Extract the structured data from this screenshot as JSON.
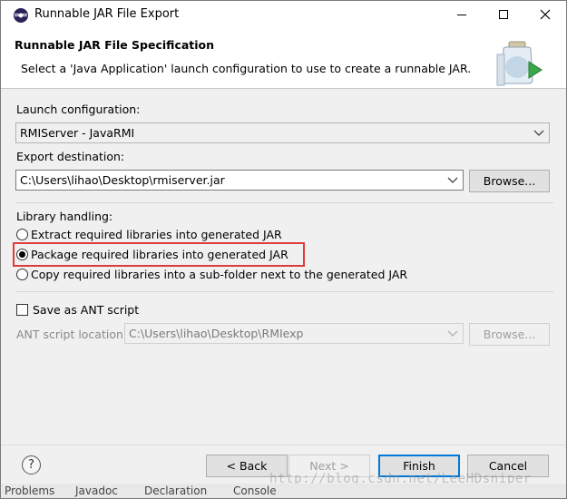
{
  "window": {
    "title": "Runnable JAR File Export"
  },
  "header": {
    "title": "Runnable JAR File Specification",
    "description": "Select a 'Java Application' launch configuration to use to create a runnable JAR."
  },
  "launch": {
    "label": "Launch configuration:",
    "value": "RMIServer - JavaRMI"
  },
  "export": {
    "label": "Export destination:",
    "value": "C:\\Users\\lihao\\Desktop\\rmiserver.jar",
    "browse_label": "Browse..."
  },
  "library": {
    "label": "Library handling:",
    "options": [
      {
        "label": "Extract required libraries into generated JAR",
        "checked": false
      },
      {
        "label": "Package required libraries into generated JAR",
        "checked": true
      },
      {
        "label": "Copy required libraries into a sub-folder next to the generated JAR",
        "checked": false
      }
    ]
  },
  "ant": {
    "checkbox_label": "Save as ANT script",
    "checked": false,
    "location_label": "ANT script location:",
    "location_value": "C:\\Users\\lihao\\Desktop\\RMIexp",
    "browse_label": "Browse..."
  },
  "footer": {
    "help_icon": "question-mark-icon",
    "back_label": "< Back",
    "next_label": "Next >",
    "finish_label": "Finish",
    "cancel_label": "Cancel"
  },
  "watermark": "http://blog.csdn.net/LeeHDsniper",
  "background_tabs": [
    "Problems",
    "Javadoc",
    "Declaration",
    "Console"
  ],
  "colors": {
    "highlight_box": "#e03a3a",
    "default_button_border": "#0078d7"
  }
}
